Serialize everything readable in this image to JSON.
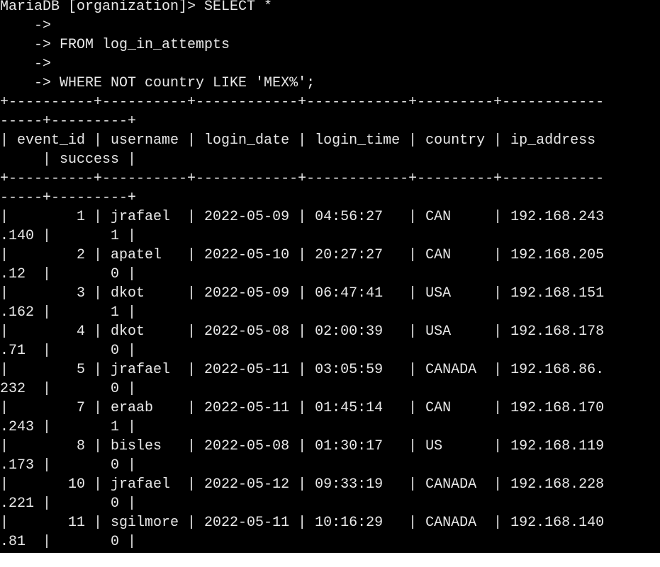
{
  "terminal": {
    "lines": [
      "MariaDB [organization]> SELECT *",
      "    ->",
      "    -> FROM log_in_attempts",
      "    ->",
      "    -> WHERE NOT country LIKE 'MEX%';",
      "+----------+----------+------------+------------+---------+------------",
      "-----+---------+",
      "| event_id | username | login_date | login_time | country | ip_address",
      "     | success |",
      "+----------+----------+------------+------------+---------+------------",
      "-----+---------+",
      "|        1 | jrafael  | 2022-05-09 | 04:56:27   | CAN     | 192.168.243",
      ".140 |       1 |",
      "|        2 | apatel   | 2022-05-10 | 20:27:27   | CAN     | 192.168.205",
      ".12  |       0 |",
      "|        3 | dkot     | 2022-05-09 | 06:47:41   | USA     | 192.168.151",
      ".162 |       1 |",
      "|        4 | dkot     | 2022-05-08 | 02:00:39   | USA     | 192.168.178",
      ".71  |       0 |",
      "|        5 | jrafael  | 2022-05-11 | 03:05:59   | CANADA  | 192.168.86.",
      "232  |       0 |",
      "|        7 | eraab    | 2022-05-11 | 01:45:14   | CAN     | 192.168.170",
      ".243 |       1 |",
      "|        8 | bisles   | 2022-05-08 | 01:30:17   | US      | 192.168.119",
      ".173 |       0 |",
      "|       10 | jrafael  | 2022-05-12 | 09:33:19   | CANADA  | 192.168.228",
      ".221 |       0 |",
      "|       11 | sgilmore | 2022-05-11 | 10:16:29   | CANADA  | 192.168.140",
      ".81  |       0 |"
    ]
  }
}
